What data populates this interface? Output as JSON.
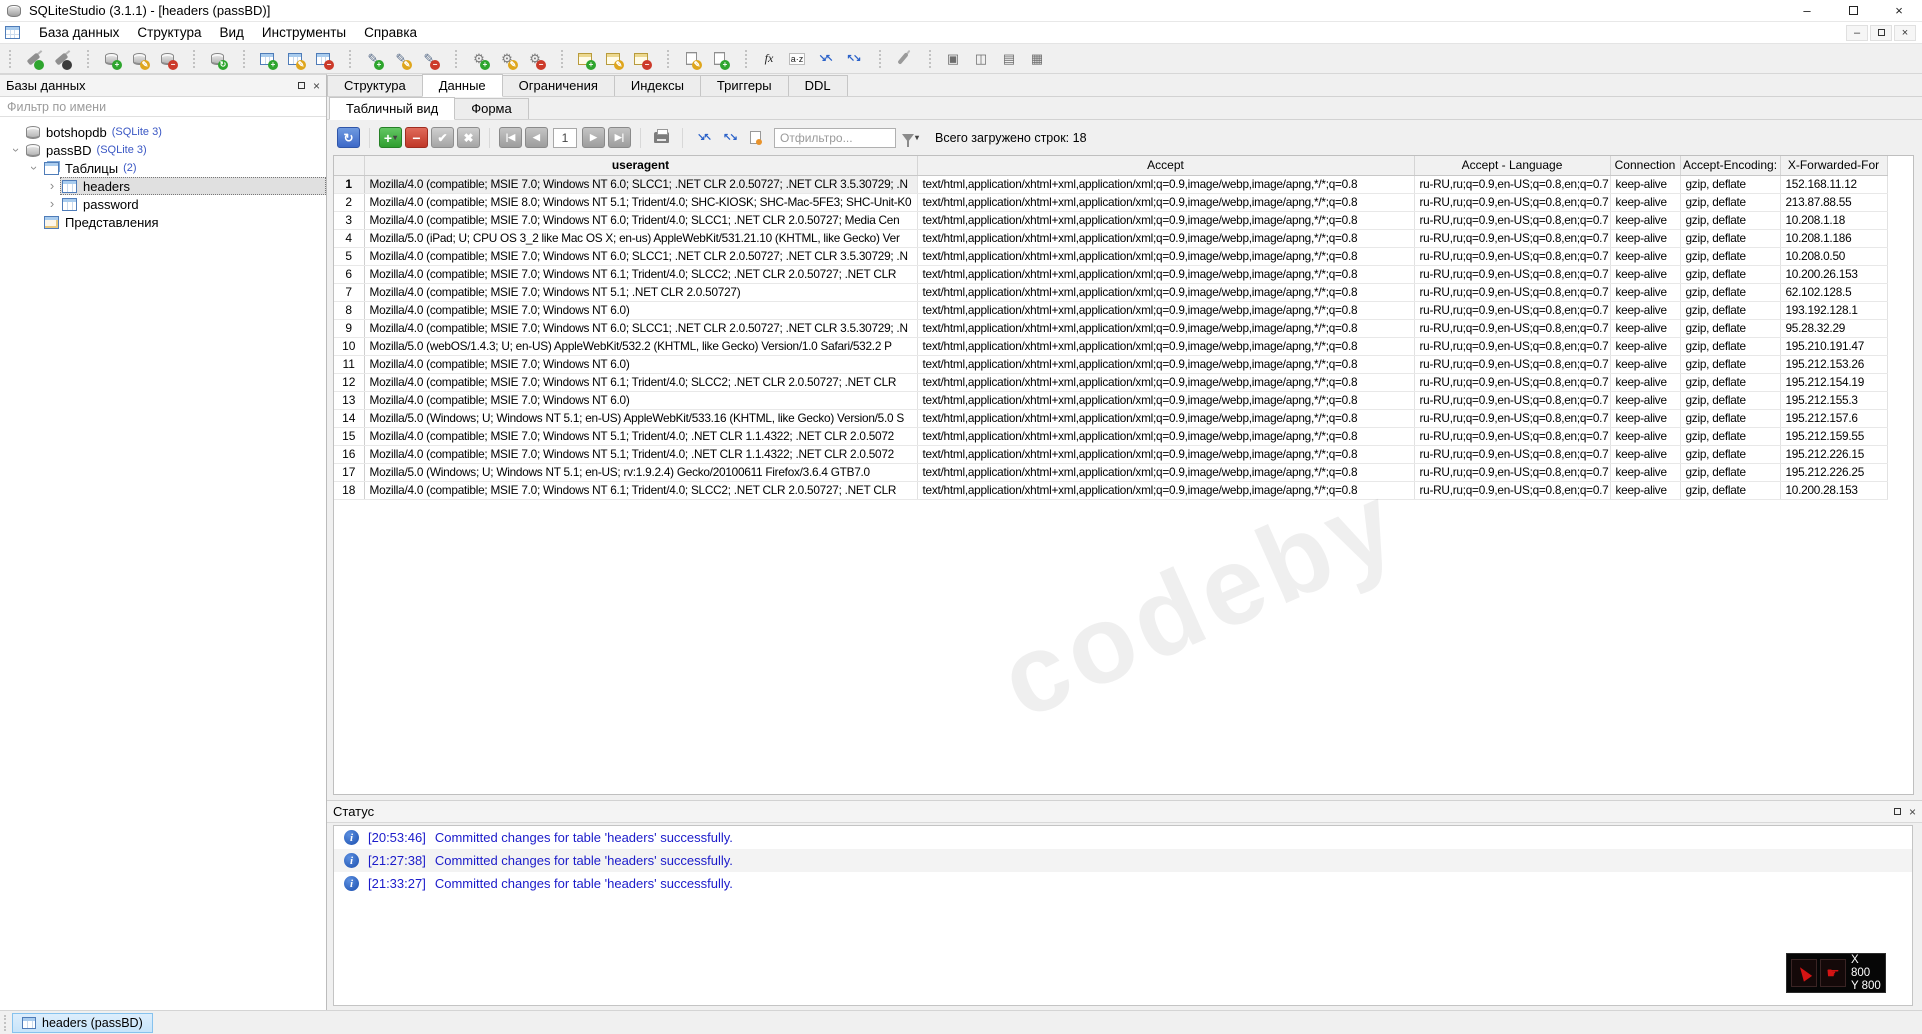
{
  "window": {
    "title": "SQLiteStudio (3.1.1) - [headers (passBD)]"
  },
  "menu": {
    "items": [
      "База данных",
      "Структура",
      "Вид",
      "Инструменты",
      "Справка"
    ]
  },
  "toolbar": {
    "groups": [
      [
        {
          "name": "connect-database-icon",
          "base": "plug",
          "badge": "on"
        },
        {
          "name": "disconnect-database-icon",
          "base": "plug",
          "badge": "off"
        }
      ],
      [
        {
          "name": "add-database-icon",
          "base": "db",
          "badge": "add"
        },
        {
          "name": "edit-database-icon",
          "base": "db",
          "badge": "edit"
        },
        {
          "name": "remove-database-icon",
          "base": "db",
          "badge": "del"
        }
      ],
      [
        {
          "name": "refresh-all-databases-icon",
          "base": "db",
          "badge": "refresh"
        }
      ],
      [
        {
          "name": "new-table-icon",
          "base": "table",
          "badge": "add"
        },
        {
          "name": "edit-table-icon",
          "base": "table",
          "badge": "edit"
        },
        {
          "name": "drop-table-icon",
          "base": "table",
          "badge": "del"
        }
      ],
      [
        {
          "name": "new-index-icon",
          "base": "pen",
          "badge": "add",
          "text": "✎"
        },
        {
          "name": "edit-index-icon",
          "base": "pen",
          "badge": "edit",
          "text": "✎"
        },
        {
          "name": "drop-index-icon",
          "base": "pen",
          "badge": "del",
          "text": "✎"
        }
      ],
      [
        {
          "name": "new-trigger-icon",
          "base": "gear",
          "badge": "add",
          "text": "⚙"
        },
        {
          "name": "edit-trigger-icon",
          "base": "gear",
          "badge": "edit",
          "text": "⚙"
        },
        {
          "name": "drop-trigger-icon",
          "base": "gear",
          "badge": "del",
          "text": "⚙"
        }
      ],
      [
        {
          "name": "new-view-icon",
          "base": "table2",
          "badge": "add"
        },
        {
          "name": "edit-view-icon",
          "base": "table2",
          "badge": "edit"
        },
        {
          "name": "drop-view-icon",
          "base": "table2",
          "badge": "del"
        }
      ],
      [
        {
          "name": "open-sql-editor-icon",
          "base": "doc",
          "badge": "edit"
        },
        {
          "name": "import-data-icon",
          "base": "doc",
          "badge": "add"
        }
      ],
      [
        {
          "name": "custom-functions-icon",
          "base": "fx",
          "text": "fx"
        },
        {
          "name": "collations-icon",
          "base": "az",
          "text": "a·z"
        },
        {
          "name": "previous-window-icon",
          "base": "fit",
          "text": "↘↖"
        },
        {
          "name": "next-window-icon",
          "base": "fit",
          "text": "↖↘"
        }
      ],
      [
        {
          "name": "configuration-icon",
          "base": "wrench"
        }
      ],
      [
        {
          "name": "mdi-tab-windows-icon",
          "base": "mdi",
          "text": "▣"
        },
        {
          "name": "mdi-tile-vertical-icon",
          "base": "mdi",
          "text": "◫"
        },
        {
          "name": "mdi-tile-horizontal-icon",
          "base": "mdi",
          "text": "▤"
        },
        {
          "name": "mdi-cascade-windows-icon",
          "base": "mdi",
          "text": "▦"
        }
      ]
    ]
  },
  "sidebar": {
    "title": "Базы данных",
    "filter_placeholder": "Фильтр по имени",
    "tree": [
      {
        "id": "botshopdb",
        "indent": 0,
        "chevron": "none",
        "icon": "db",
        "label": "botshopdb",
        "suffix": "(SQLite 3)",
        "selected": false
      },
      {
        "id": "passbd",
        "indent": 0,
        "chevron": "open",
        "icon": "db",
        "label": "passBD",
        "suffix": "(SQLite 3)",
        "selected": false
      },
      {
        "id": "tables",
        "indent": 1,
        "chevron": "open",
        "icon": "tables",
        "label": "Таблицы",
        "suffix": "(2)",
        "selected": false
      },
      {
        "id": "headers",
        "indent": 2,
        "chevron": "closed",
        "icon": "table",
        "label": "headers",
        "suffix": "",
        "selected": true
      },
      {
        "id": "password",
        "indent": 2,
        "chevron": "closed",
        "icon": "table",
        "label": "password",
        "suffix": "",
        "selected": false
      },
      {
        "id": "views",
        "indent": 1,
        "chevron": "none",
        "icon": "view",
        "label": "Представления",
        "suffix": "",
        "selected": false
      }
    ]
  },
  "tabs": [
    {
      "id": "structure",
      "label": "Структура",
      "active": false
    },
    {
      "id": "data",
      "label": "Данные",
      "active": true
    },
    {
      "id": "constraints",
      "label": "Ограничения",
      "active": false
    },
    {
      "id": "indexes",
      "label": "Индексы",
      "active": false
    },
    {
      "id": "triggers",
      "label": "Триггеры",
      "active": false
    },
    {
      "id": "ddl",
      "label": "DDL",
      "active": false
    }
  ],
  "subtabs": [
    {
      "id": "grid-view",
      "label": "Табличный вид",
      "active": true
    },
    {
      "id": "form-view",
      "label": "Форма",
      "active": false
    }
  ],
  "grid_toolbar": {
    "page_number": "1",
    "filter_placeholder": "Отфильтро...",
    "rows_loaded": "Всего загружено строк: 18",
    "items": [
      {
        "t": "btn",
        "name": "refresh-table-data",
        "cls": "gb-blue",
        "glyph": "↻"
      },
      {
        "t": "sep"
      },
      {
        "t": "btn",
        "name": "add-row",
        "cls": "gb-green",
        "glyph": "+",
        "caret": true
      },
      {
        "t": "btn",
        "name": "delete-row",
        "cls": "gb-red",
        "glyph": "−"
      },
      {
        "t": "btn",
        "name": "commit-changes",
        "cls": "gb-gray",
        "glyph": "✔"
      },
      {
        "t": "btn",
        "name": "rollback-changes",
        "cls": "gb-gray",
        "glyph": "✖"
      },
      {
        "t": "sep"
      },
      {
        "t": "btn",
        "name": "first-page",
        "cls": "gb-nav",
        "glyph": "|◀"
      },
      {
        "t": "btn",
        "name": "previous-page",
        "cls": "gb-nav",
        "glyph": "◀"
      },
      {
        "t": "page"
      },
      {
        "t": "btn",
        "name": "next-page",
        "cls": "gb-nav",
        "glyph": "▶"
      },
      {
        "t": "btn",
        "name": "last-page",
        "cls": "gb-nav",
        "glyph": "▶|"
      },
      {
        "t": "sep"
      },
      {
        "t": "btn",
        "name": "print-results",
        "cls": "gb-flat",
        "icon": "printer"
      },
      {
        "t": "sep"
      },
      {
        "t": "btn",
        "name": "fit-columns-width",
        "cls": "gb-flat",
        "glyph": "↘↖",
        "blue": true
      },
      {
        "t": "btn",
        "name": "fit-rows-height",
        "cls": "gb-flat",
        "glyph": "↖↘",
        "blue": true
      },
      {
        "t": "btn",
        "name": "load-full-data",
        "cls": "gb-flat",
        "icon": "docload"
      },
      {
        "t": "input"
      },
      {
        "t": "funnel",
        "name": "filter-type-dropdown"
      },
      {
        "t": "label"
      }
    ]
  },
  "table": {
    "selected_row": 1,
    "columns": [
      "useragent",
      "Accept",
      "Accept - Language",
      "Connection",
      "Accept-Encoding:",
      "X-Forwarded-For"
    ],
    "rows": [
      [
        "1",
        "Mozilla/4.0 (compatible; MSIE 7.0; Windows NT 6.0; SLCC1; .NET CLR 2.0.50727; .NET CLR 3.5.30729; .N",
        "text/html,application/xhtml+xml,application/xml;q=0.9,image/webp,image/apng,*/*;q=0.8",
        "ru-RU,ru;q=0.9,en-US;q=0.8,en;q=0.7",
        "keep-alive",
        "gzip, deflate",
        "152.168.11.12"
      ],
      [
        "2",
        "Mozilla/4.0 (compatible; MSIE 8.0; Windows NT 5.1; Trident/4.0; SHC-KIOSK; SHC-Mac-5FE3; SHC-Unit-K0",
        "text/html,application/xhtml+xml,application/xml;q=0.9,image/webp,image/apng,*/*;q=0.8",
        "ru-RU,ru;q=0.9,en-US;q=0.8,en;q=0.7",
        "keep-alive",
        "gzip, deflate",
        "213.87.88.55"
      ],
      [
        "3",
        "Mozilla/4.0 (compatible; MSIE 7.0; Windows NT 6.0; Trident/4.0; SLCC1; .NET CLR 2.0.50727; Media Cen",
        "text/html,application/xhtml+xml,application/xml;q=0.9,image/webp,image/apng,*/*;q=0.8",
        "ru-RU,ru;q=0.9,en-US;q=0.8,en;q=0.7",
        "keep-alive",
        "gzip, deflate",
        "10.208.1.18"
      ],
      [
        "4",
        "Mozilla/5.0 (iPad; U; CPU OS 3_2 like Mac OS X; en-us) AppleWebKit/531.21.10 (KHTML, like Gecko) Ver",
        "text/html,application/xhtml+xml,application/xml;q=0.9,image/webp,image/apng,*/*;q=0.8",
        "ru-RU,ru;q=0.9,en-US;q=0.8,en;q=0.7",
        "keep-alive",
        "gzip, deflate",
        "10.208.1.186"
      ],
      [
        "5",
        "Mozilla/4.0 (compatible; MSIE 7.0; Windows NT 6.0; SLCC1; .NET CLR 2.0.50727; .NET CLR 3.5.30729; .N",
        "text/html,application/xhtml+xml,application/xml;q=0.9,image/webp,image/apng,*/*;q=0.8",
        "ru-RU,ru;q=0.9,en-US;q=0.8,en;q=0.7",
        "keep-alive",
        "gzip, deflate",
        "10.208.0.50"
      ],
      [
        "6",
        "Mozilla/4.0 (compatible; MSIE 7.0; Windows NT 6.1; Trident/4.0; SLCC2; .NET CLR 2.0.50727; .NET CLR",
        "text/html,application/xhtml+xml,application/xml;q=0.9,image/webp,image/apng,*/*;q=0.8",
        "ru-RU,ru;q=0.9,en-US;q=0.8,en;q=0.7",
        "keep-alive",
        "gzip, deflate",
        "10.200.26.153"
      ],
      [
        "7",
        "Mozilla/4.0 (compatible; MSIE 7.0; Windows NT 5.1; .NET CLR 2.0.50727)",
        "text/html,application/xhtml+xml,application/xml;q=0.9,image/webp,image/apng,*/*;q=0.8",
        "ru-RU,ru;q=0.9,en-US;q=0.8,en;q=0.7",
        "keep-alive",
        "gzip, deflate",
        "62.102.128.5"
      ],
      [
        "8",
        "Mozilla/4.0 (compatible; MSIE 7.0; Windows NT 6.0)",
        "text/html,application/xhtml+xml,application/xml;q=0.9,image/webp,image/apng,*/*;q=0.8",
        "ru-RU,ru;q=0.9,en-US;q=0.8,en;q=0.7",
        "keep-alive",
        "gzip, deflate",
        "193.192.128.1"
      ],
      [
        "9",
        "Mozilla/4.0 (compatible; MSIE 7.0; Windows NT 6.0; SLCC1; .NET CLR 2.0.50727; .NET CLR 3.5.30729; .N",
        "text/html,application/xhtml+xml,application/xml;q=0.9,image/webp,image/apng,*/*;q=0.8",
        "ru-RU,ru;q=0.9,en-US;q=0.8,en;q=0.7",
        "keep-alive",
        "gzip, deflate",
        "95.28.32.29"
      ],
      [
        "10",
        "Mozilla/5.0 (webOS/1.4.3; U; en-US) AppleWebKit/532.2 (KHTML, like Gecko) Version/1.0 Safari/532.2 P",
        "text/html,application/xhtml+xml,application/xml;q=0.9,image/webp,image/apng,*/*;q=0.8",
        "ru-RU,ru;q=0.9,en-US;q=0.8,en;q=0.7",
        "keep-alive",
        "gzip, deflate",
        "195.210.191.47"
      ],
      [
        "11",
        "Mozilla/4.0 (compatible; MSIE 7.0; Windows NT 6.0)",
        "text/html,application/xhtml+xml,application/xml;q=0.9,image/webp,image/apng,*/*;q=0.8",
        "ru-RU,ru;q=0.9,en-US;q=0.8,en;q=0.7",
        "keep-alive",
        "gzip, deflate",
        "195.212.153.26"
      ],
      [
        "12",
        "Mozilla/4.0 (compatible; MSIE 7.0; Windows NT 6.1; Trident/4.0; SLCC2; .NET CLR 2.0.50727; .NET CLR",
        "text/html,application/xhtml+xml,application/xml;q=0.9,image/webp,image/apng,*/*;q=0.8",
        "ru-RU,ru;q=0.9,en-US;q=0.8,en;q=0.7",
        "keep-alive",
        "gzip, deflate",
        "195.212.154.19"
      ],
      [
        "13",
        "Mozilla/4.0 (compatible; MSIE 7.0; Windows NT 6.0)",
        "text/html,application/xhtml+xml,application/xml;q=0.9,image/webp,image/apng,*/*;q=0.8",
        "ru-RU,ru;q=0.9,en-US;q=0.8,en;q=0.7",
        "keep-alive",
        "gzip, deflate",
        "195.212.155.3"
      ],
      [
        "14",
        "Mozilla/5.0 (Windows; U; Windows NT 5.1; en-US) AppleWebKit/533.16 (KHTML, like Gecko) Version/5.0 S",
        "text/html,application/xhtml+xml,application/xml;q=0.9,image/webp,image/apng,*/*;q=0.8",
        "ru-RU,ru;q=0.9,en-US;q=0.8,en;q=0.7",
        "keep-alive",
        "gzip, deflate",
        "195.212.157.6"
      ],
      [
        "15",
        "Mozilla/4.0 (compatible; MSIE 7.0; Windows NT 5.1; Trident/4.0; .NET CLR 1.1.4322; .NET CLR 2.0.5072",
        "text/html,application/xhtml+xml,application/xml;q=0.9,image/webp,image/apng,*/*;q=0.8",
        "ru-RU,ru;q=0.9,en-US;q=0.8,en;q=0.7",
        "keep-alive",
        "gzip, deflate",
        "195.212.159.55"
      ],
      [
        "16",
        "Mozilla/4.0 (compatible; MSIE 7.0; Windows NT 5.1; Trident/4.0; .NET CLR 1.1.4322; .NET CLR 2.0.5072",
        "text/html,application/xhtml+xml,application/xml;q=0.9,image/webp,image/apng,*/*;q=0.8",
        "ru-RU,ru;q=0.9,en-US;q=0.8,en;q=0.7",
        "keep-alive",
        "gzip, deflate",
        "195.212.226.15"
      ],
      [
        "17",
        "Mozilla/5.0 (Windows; U; Windows NT 5.1; en-US; rv:1.9.2.4) Gecko/20100611 Firefox/3.6.4 GTB7.0",
        "text/html,application/xhtml+xml,application/xml;q=0.9,image/webp,image/apng,*/*;q=0.8",
        "ru-RU,ru;q=0.9,en-US;q=0.8,en;q=0.7",
        "keep-alive",
        "gzip, deflate",
        "195.212.226.25"
      ],
      [
        "18",
        "Mozilla/4.0 (compatible; MSIE 7.0; Windows NT 6.1; Trident/4.0; SLCC2; .NET CLR 2.0.50727; .NET CLR",
        "text/html,application/xhtml+xml,application/xml;q=0.9,image/webp,image/apng,*/*;q=0.8",
        "ru-RU,ru;q=0.9,en-US;q=0.8,en;q=0.7",
        "keep-alive",
        "gzip, deflate",
        "10.200.28.153"
      ]
    ]
  },
  "status": {
    "title": "Статус",
    "messages": [
      {
        "time": "[20:53:46]",
        "text": "Committed changes for table 'headers' successfully."
      },
      {
        "time": "[21:27:38]",
        "text": "Committed changes for table 'headers' successfully."
      },
      {
        "time": "[21:33:27]",
        "text": "Committed changes for table 'headers' successfully."
      }
    ]
  },
  "taskbar": {
    "tab_label": "headers (passBD)"
  },
  "overlay": {
    "x_label": "X 800",
    "y_label": "Y 800"
  },
  "watermark": "codeby",
  "colors": {
    "accent_blue": "#3c68c8",
    "status_text": "#1b1bca",
    "version_label": "#3a57c4",
    "task_tab_bg": "#cfe8fc"
  }
}
